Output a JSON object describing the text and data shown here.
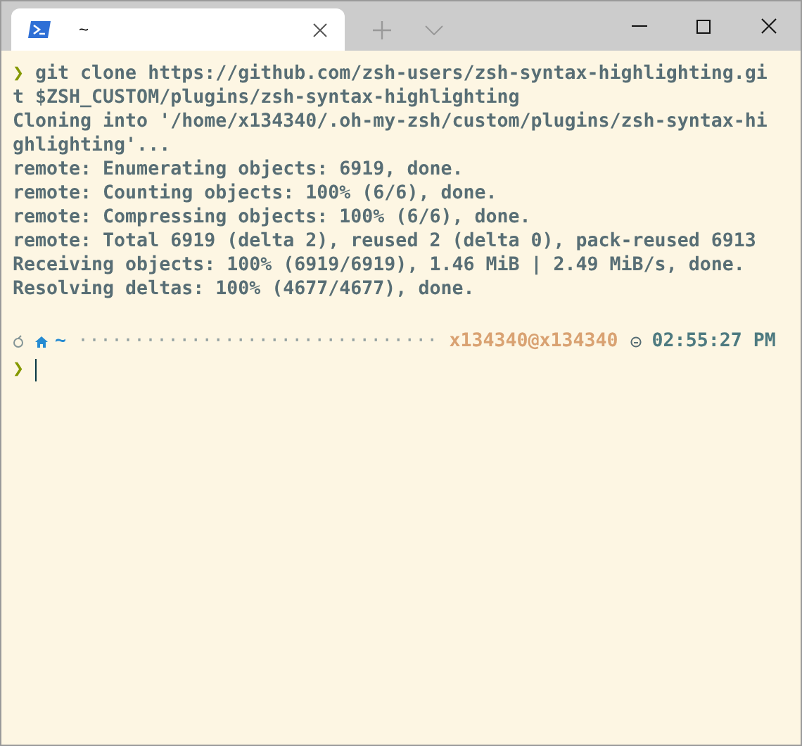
{
  "tab": {
    "title": "~",
    "selected": true
  },
  "terminal": {
    "lines": [
      {
        "kind": "command",
        "prompt": "❯",
        "text": "git clone https://github.com/zsh-users/zsh-syntax-highlighting.gi"
      },
      {
        "kind": "output",
        "text": "t $ZSH_CUSTOM/plugins/zsh-syntax-highlighting"
      },
      {
        "kind": "output",
        "text": "Cloning into '/home/x134340/.oh-my-zsh/custom/plugins/zsh-syntax-hi"
      },
      {
        "kind": "output",
        "text": "ghlighting'..."
      },
      {
        "kind": "output",
        "text": "remote: Enumerating objects: 6919, done."
      },
      {
        "kind": "output",
        "text": "remote: Counting objects: 100% (6/6), done."
      },
      {
        "kind": "output",
        "text": "remote: Compressing objects: 100% (6/6), done."
      },
      {
        "kind": "output",
        "text": "remote: Total 6919 (delta 2), reused 2 (delta 0), pack-reused 6913"
      },
      {
        "kind": "output",
        "text": "Receiving objects: 100% (6919/6919), 1.46 MiB | 2.49 MiB/s, done."
      },
      {
        "kind": "output",
        "text": "Resolving deltas: 100% (4677/4677), done."
      },
      {
        "kind": "blank"
      },
      {
        "kind": "status",
        "dir": "~",
        "filler": "································",
        "user": "x134340@x134340",
        "time": "02:55:27 PM"
      },
      {
        "kind": "input",
        "prompt": "❯"
      }
    ]
  }
}
